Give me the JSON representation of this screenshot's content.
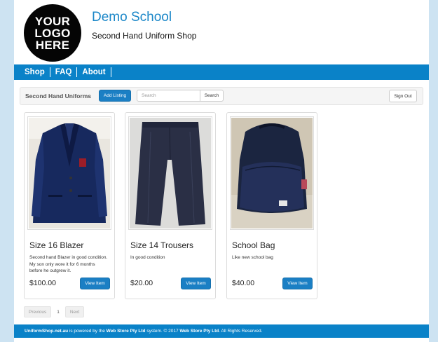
{
  "logo": {
    "line1": "YOUR",
    "line2": "LOGO",
    "line3": "HERE"
  },
  "school": {
    "name": "Demo School",
    "tagline": "Second Hand Uniform Shop"
  },
  "nav": {
    "items": [
      {
        "label": "Shop"
      },
      {
        "label": "FAQ"
      },
      {
        "label": "About"
      }
    ]
  },
  "toolbar": {
    "brand": "Second Hand Uniforms",
    "add_listing_label": "Add Listing",
    "search_placeholder": "Search",
    "search_label": "Search",
    "signout_label": "Sign Out"
  },
  "listings": [
    {
      "title": "Size 16 Blazer",
      "description": "Second hand Blazer in good condition. My son only wore it for 6 months before he outgrew it.",
      "price": "$100.00",
      "button_label": "View Item",
      "image": "blazer-photo"
    },
    {
      "title": "Size 14 Trousers",
      "description": "In good condition",
      "price": "$20.00",
      "button_label": "View Item",
      "image": "trousers-photo"
    },
    {
      "title": "School Bag",
      "description": "Like new school bag",
      "price": "$40.00",
      "button_label": "View Item",
      "image": "backpack-photo"
    }
  ],
  "pagination": {
    "previous_label": "Previous",
    "current_page": "1",
    "next_label": "Next"
  },
  "footer": {
    "site": "UniformShop.net.au",
    "text1": " is powered by the ",
    "company": "Web Store Pty Ltd",
    "text2": " system. © 2017 ",
    "company2": "Web Store Pty Ltd",
    "text3": ". All Rights Reserved."
  },
  "colors": {
    "brand_blue": "#0a82c8",
    "title_blue": "#1b87c8",
    "button_blue": "#1b7fc4",
    "background": "#cde3f2"
  }
}
